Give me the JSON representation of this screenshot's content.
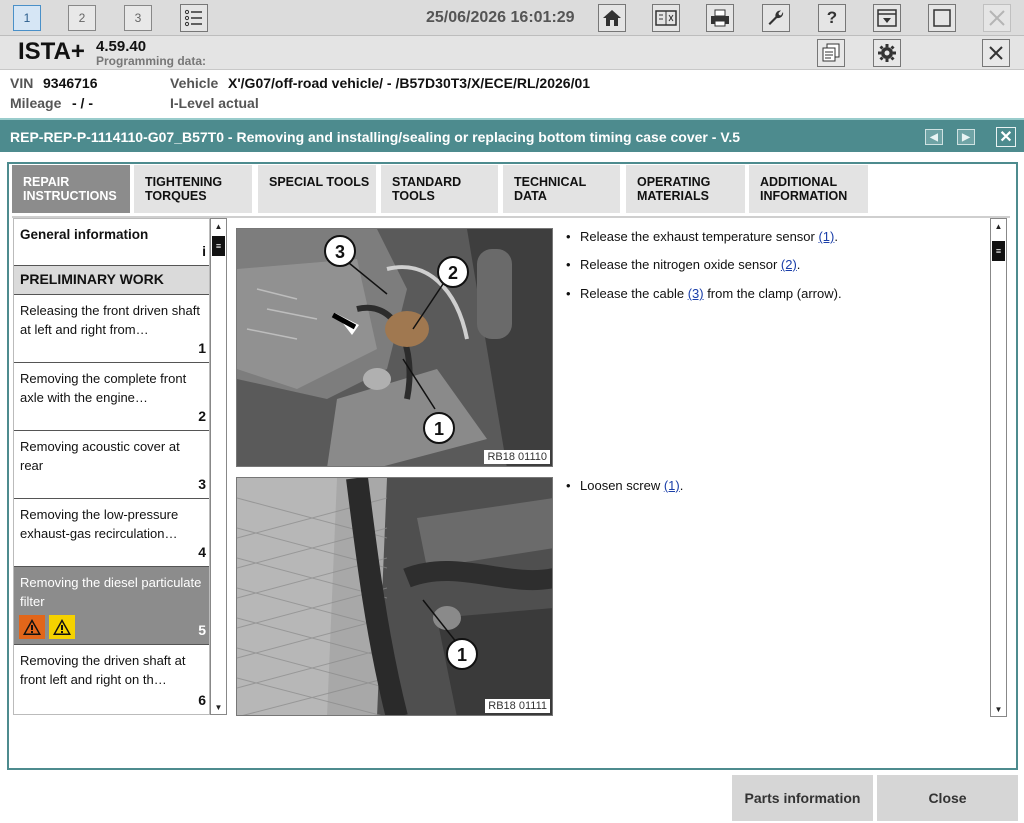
{
  "topbar": {
    "tabs": [
      "1",
      "2",
      "3"
    ],
    "datetime": "25/06/2026 16:01:29"
  },
  "app": {
    "name": "ISTA+",
    "version": "4.59.40",
    "programming_label": "Programming data:"
  },
  "info": {
    "vin_label": "VIN",
    "vin": "9346716",
    "mileage_label": "Mileage",
    "mileage": "- / -",
    "vehicle_label": "Vehicle",
    "vehicle": "X'/G07/off-road vehicle/ - /B57D30T3/X/ECE/RL/2026/01",
    "ilevel_label": "I-Level actual"
  },
  "document": {
    "title": "REP-REP-P-1114110-G07_B57T0 - Removing and installing/sealing or replacing bottom timing case cover - V.5"
  },
  "tabs": [
    {
      "label": "REPAIR\nINSTRUCTIONS"
    },
    {
      "label": "TIGHTENING\nTORQUES"
    },
    {
      "label": "SPECIAL TOOLS"
    },
    {
      "label": "STANDARD\nTOOLS"
    },
    {
      "label": "TECHNICAL\nDATA"
    },
    {
      "label": "OPERATING\nMATERIALS"
    },
    {
      "label": "ADDITIONAL\nINFORMATION"
    }
  ],
  "sidebar": {
    "general": {
      "label": "General information",
      "marker": "i"
    },
    "section": "PRELIMINARY WORK",
    "items": [
      {
        "label": "Releasing the front driven shaft at left and right from…",
        "num": "1"
      },
      {
        "label": "Removing the complete front axle with the engine…",
        "num": "2"
      },
      {
        "label": "Removing acoustic cover at rear",
        "num": "3"
      },
      {
        "label": "Removing the low-pressure exhaust-gas recirculation…",
        "num": "4"
      },
      {
        "label": "Removing the diesel particulate filter",
        "num": "5"
      },
      {
        "label": "Removing the driven shaft at front left and right on th…",
        "num": "6"
      }
    ]
  },
  "steps": {
    "image1": {
      "caption": "RB18 01110",
      "callouts": [
        "3",
        "2",
        "1"
      ]
    },
    "image2": {
      "caption": "RB18 01111",
      "callouts": [
        "1"
      ]
    },
    "s1": {
      "text": "Release the exhaust temperature sensor ",
      "ref": "(1)",
      "end": "."
    },
    "s2": {
      "text": "Release the nitrogen oxide sensor ",
      "ref": "(2)",
      "end": "."
    },
    "s3": {
      "text": "Release the cable ",
      "ref": "(3)",
      "end": " from the clamp (arrow)."
    },
    "s4": {
      "text": "Loosen screw ",
      "ref": "(1)",
      "end": "."
    }
  },
  "buttons": {
    "parts": "Parts information",
    "close": "Close"
  },
  "colors": {
    "title_bar": "#4d8b8e",
    "selected": "#8c8c8c",
    "link": "#1a3ea8",
    "warning_orange": "#e2661a",
    "warning_yellow": "#f5d200"
  }
}
